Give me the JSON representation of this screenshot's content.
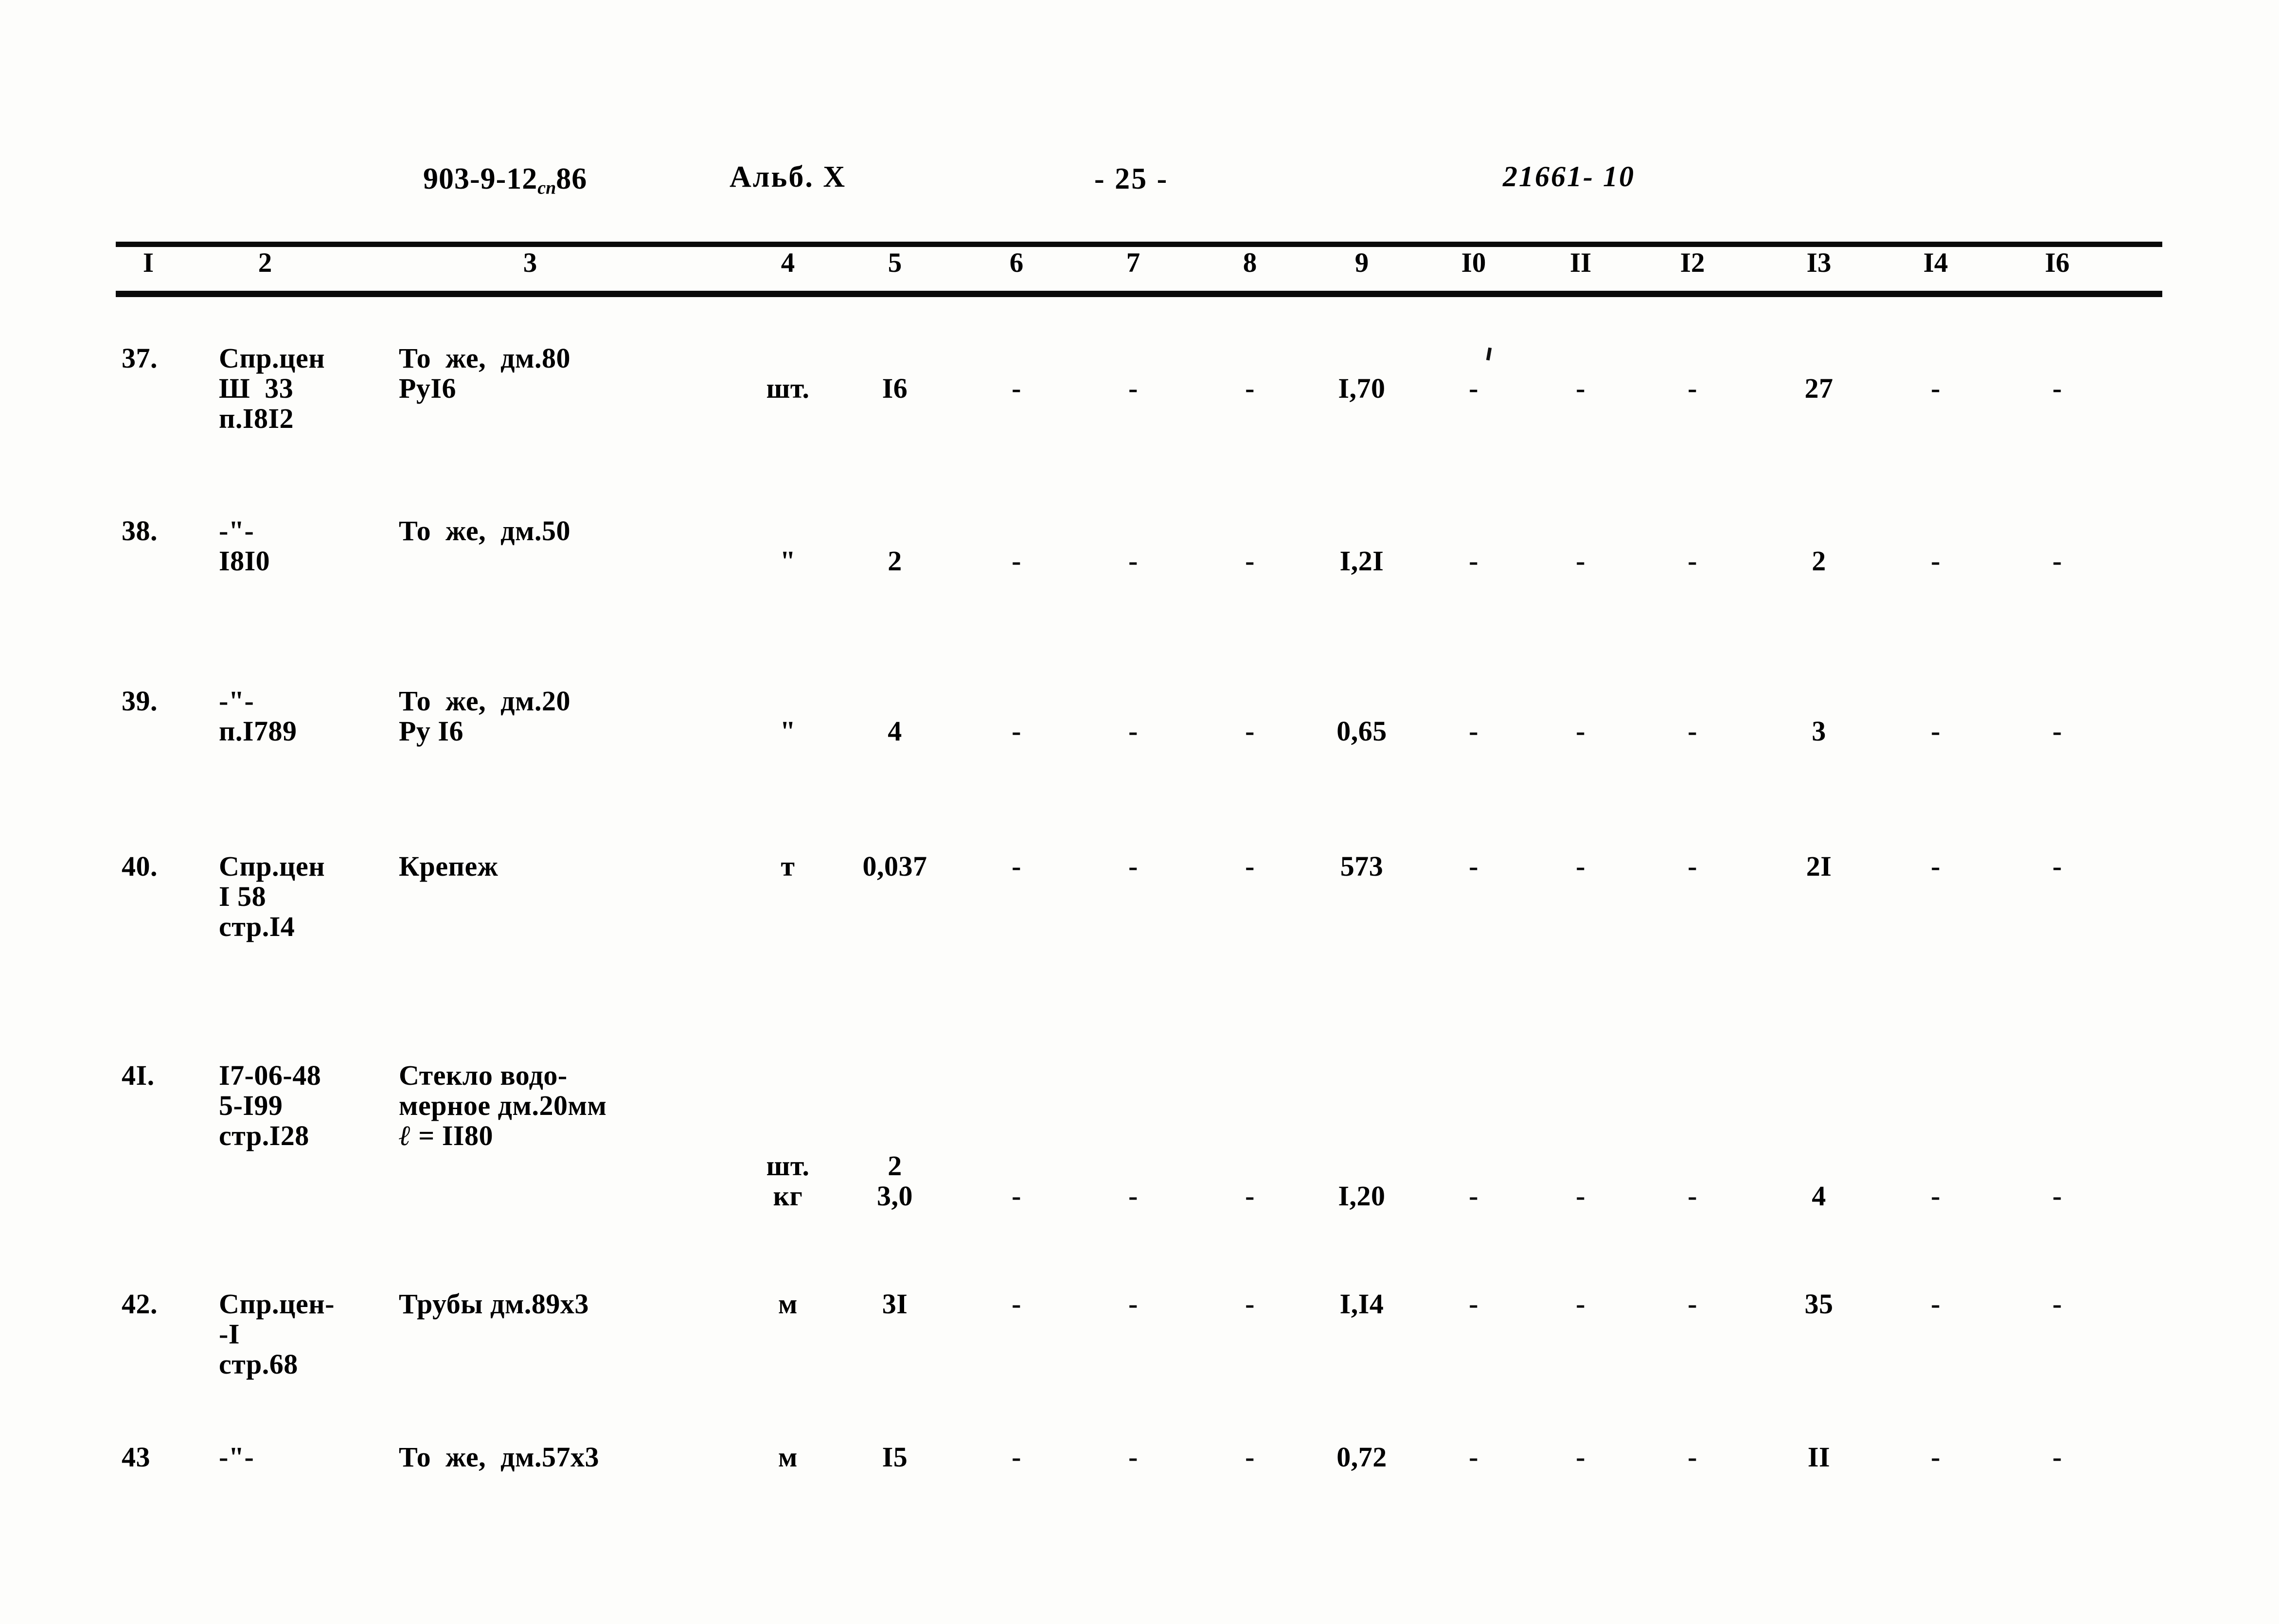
{
  "header": {
    "project_code_main": "903-9-12",
    "project_code_sub": "сп",
    "project_code_year": "86",
    "album": "Альб. X",
    "page": "- 25 -",
    "doc_number": "21661- 10"
  },
  "table": {
    "column_numbers": [
      "I",
      "2",
      "3",
      "4",
      "5",
      "6",
      "7",
      "8",
      "9",
      "I0",
      "II",
      "I2",
      "I3",
      "I4",
      "I6"
    ],
    "rows": [
      {
        "no": "37.",
        "code": [
          "Спр.цен",
          "Ш  33",
          "п.I8I2"
        ],
        "name": [
          "То  же,  дм.80",
          "РуI6"
        ],
        "unit": "шт.",
        "c5": "I6",
        "c6": "-",
        "c7": "-",
        "c8": "-",
        "c9": "I,70",
        "c10": "-",
        "c11": "-",
        "c12": "-",
        "c13": "27",
        "c14": "-",
        "c16": "-"
      },
      {
        "no": "38.",
        "code": [
          "-\"-",
          "I8I0"
        ],
        "name": [
          "То  же,  дм.50"
        ],
        "unit": "\"",
        "c5": "2",
        "c6": "-",
        "c7": "-",
        "c8": "-",
        "c9": "I,2I",
        "c10": "-",
        "c11": "-",
        "c12": "-",
        "c13": "2",
        "c14": "-",
        "c16": "-"
      },
      {
        "no": "39.",
        "code": [
          "-\"-",
          "п.I789"
        ],
        "name": [
          "То  же,  дм.20",
          "Ру I6"
        ],
        "unit": "\"",
        "c5": "4",
        "c6": "-",
        "c7": "-",
        "c8": "-",
        "c9": "0,65",
        "c10": "-",
        "c11": "-",
        "c12": "-",
        "c13": "3",
        "c14": "-",
        "c16": "-"
      },
      {
        "no": "40.",
        "code": [
          "Спр.цен",
          "I 58",
          "стр.I4"
        ],
        "name": [
          "Крепеж"
        ],
        "unit": "т",
        "c5": "0,037",
        "c6": "-",
        "c7": "-",
        "c8": "-",
        "c9": "573",
        "c10": "-",
        "c11": "-",
        "c12": "-",
        "c13": "2I",
        "c14": "-",
        "c16": "-"
      },
      {
        "no": "4I.",
        "code": [
          "I7-06-48",
          "5-I99",
          "стр.I28"
        ],
        "name": [
          "Стекло водо-",
          "мерное дм.20мм",
          "ℓ = II80"
        ],
        "unit": "шт.",
        "c5": "2",
        "unit2": "кг",
        "c5_2": "3,0",
        "c6": "-",
        "c7": "-",
        "c8": "-",
        "c9": "I,20",
        "c10": "-",
        "c11": "-",
        "c12": "-",
        "c13": "4",
        "c14": "-",
        "c16": "-"
      },
      {
        "no": "42.",
        "code": [
          "Спр.цен-",
          "-I",
          "стр.68"
        ],
        "name": [
          "Трубы дм.89х3"
        ],
        "unit": "м",
        "c5": "3I",
        "c6": "-",
        "c7": "-",
        "c8": "-",
        "c9": "I,I4",
        "c10": "-",
        "c11": "-",
        "c12": "-",
        "c13": "35",
        "c14": "-",
        "c16": "-"
      },
      {
        "no": "43",
        "code": [
          "-\"-"
        ],
        "name": [
          "То  же,  дм.57х3"
        ],
        "unit": "м",
        "c5": "I5",
        "c6": "-",
        "c7": "-",
        "c8": "-",
        "c9": "0,72",
        "c10": "-",
        "c11": "-",
        "c12": "-",
        "c13": "II",
        "c14": "-",
        "c16": "-"
      }
    ]
  }
}
